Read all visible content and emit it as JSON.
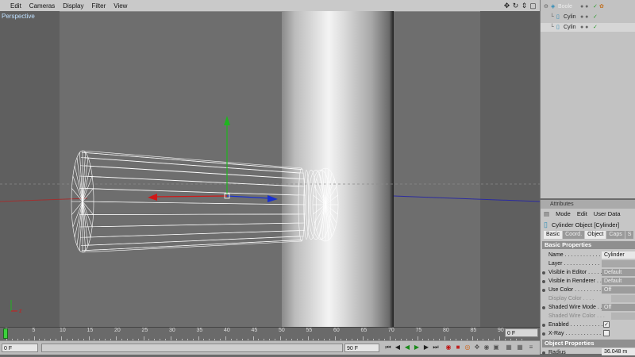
{
  "viewport": {
    "menu": [
      "Edit",
      "Cameras",
      "Display",
      "Filter",
      "View"
    ],
    "label": "Perspective",
    "icons": [
      "move-view-icon",
      "rotate-view-icon",
      "zoom-view-icon",
      "maximize-view-icon"
    ]
  },
  "timeline": {
    "ticks": [
      "0",
      "5",
      "10",
      "15",
      "20",
      "25",
      "30",
      "35",
      "40",
      "45",
      "50",
      "55",
      "60",
      "65",
      "70",
      "75",
      "80",
      "85",
      "90"
    ],
    "current_frame": "0 F"
  },
  "playback": {
    "start": "0 F",
    "end": "90 F"
  },
  "object_manager": {
    "items": [
      {
        "name": "Boole",
        "level": 0
      },
      {
        "name": "Cylin",
        "level": 1
      },
      {
        "name": "Cylin",
        "level": 1
      }
    ]
  },
  "attributes": {
    "title": "Attributes",
    "menu": [
      "Mode",
      "Edit",
      "User Data"
    ],
    "object_title": "Cylinder Object [Cylinder]",
    "tabs": [
      "Basic",
      "Coord.",
      "Object",
      "Caps",
      "S"
    ],
    "active_tab": "Object",
    "section": "Basic Properties",
    "properties": [
      {
        "label": "Name . . . . . . . . . . . .",
        "value": "Cylinder"
      },
      {
        "label": "Layer . . . . . . . . . . . .",
        "value": ""
      },
      {
        "label": "Visible in Editor . . . . .",
        "value": "Default"
      },
      {
        "label": "Visible in Renderer . . .",
        "value": "Default"
      },
      {
        "label": "Use Color . . . . . . . . . .",
        "value": "Off"
      },
      {
        "label": "Display Color . . . .",
        "value": ""
      },
      {
        "label": "Shaded Wire Mode . . .",
        "value": "Off"
      },
      {
        "label": "Shaded Wire Color . . .",
        "value": ""
      },
      {
        "label": "Enabled . . . . . . . . . . .",
        "value": "✓"
      },
      {
        "label": "X-Ray . . . . . . . . . . . .",
        "value": ""
      }
    ],
    "section2": "Object Properties",
    "radius_label": "Radius",
    "radius_value": "36.048 m"
  },
  "colors": {
    "panel": "#c6c6c6",
    "viewport_bg": "#6e6e6e",
    "y_axis": "#1fb51f",
    "x_axis": "#d01818",
    "z_axis": "#1830d0"
  }
}
